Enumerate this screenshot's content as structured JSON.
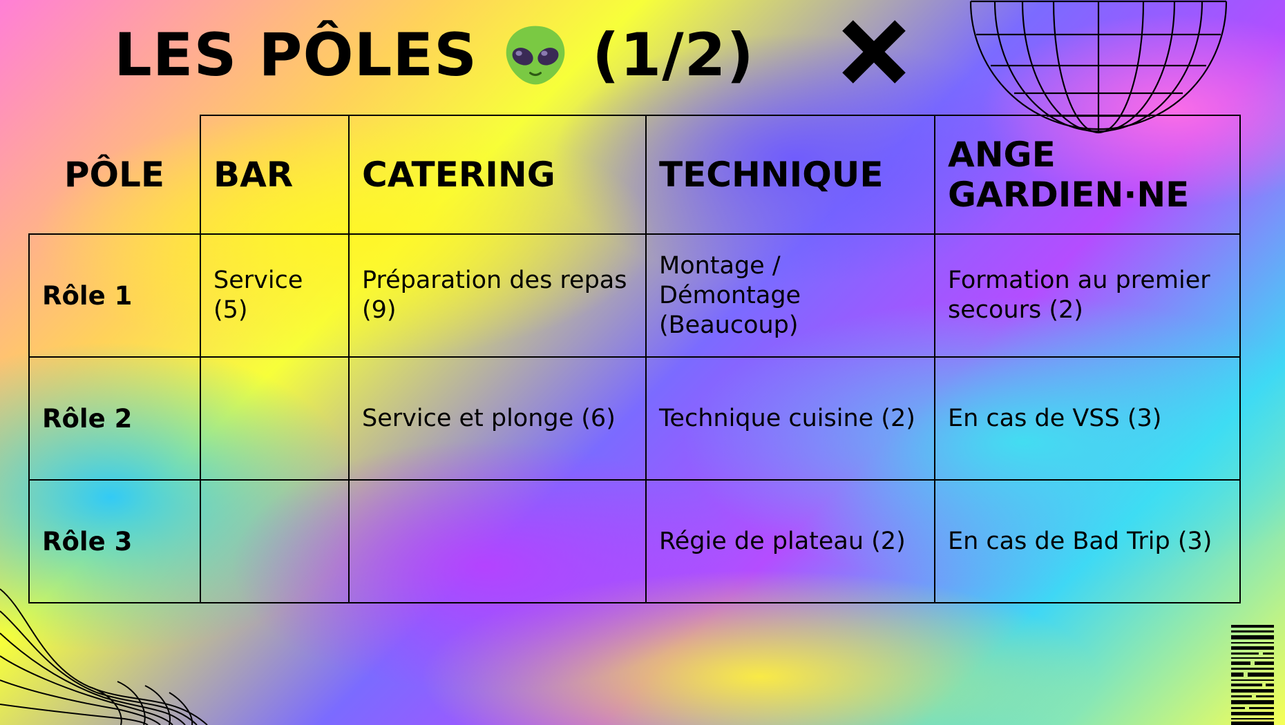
{
  "slide": {
    "title_main": "LES PÔLES",
    "title_page": "(1/2)",
    "title_emoji_icon": "alien-emoji-icon",
    "decor_icons": [
      "x-mark-icon",
      "wireframe-hemisphere-icon",
      "wireframe-wave-icon",
      "barcode-icon"
    ]
  },
  "table": {
    "headers": [
      "PÔLE",
      "BAR",
      "CATERING",
      "TECHNIQUE",
      "ANGE GARDIEN·NE"
    ],
    "rows": [
      {
        "label": "Rôle 1",
        "cells": [
          "Service (5)",
          "Préparation des repas (9)",
          "Montage / Démontage (Beaucoup)",
          "Formation au premier secours (2)"
        ]
      },
      {
        "label": "Rôle 2",
        "cells": [
          "",
          "Service et plonge (6)",
          "Technique cuisine (2)",
          "En cas de VSS (3)"
        ]
      },
      {
        "label": "Rôle 3",
        "cells": [
          "",
          "",
          "Régie de plateau (2)",
          "En cas de Bad Trip (3)"
        ]
      }
    ]
  },
  "colors": {
    "ink": "#000000",
    "yellow": "#f7ff3a",
    "violet": "#7b6bff",
    "pink": "#ff7fd6",
    "cyan": "#3fd7f5",
    "alien_green": "#7ac943"
  }
}
